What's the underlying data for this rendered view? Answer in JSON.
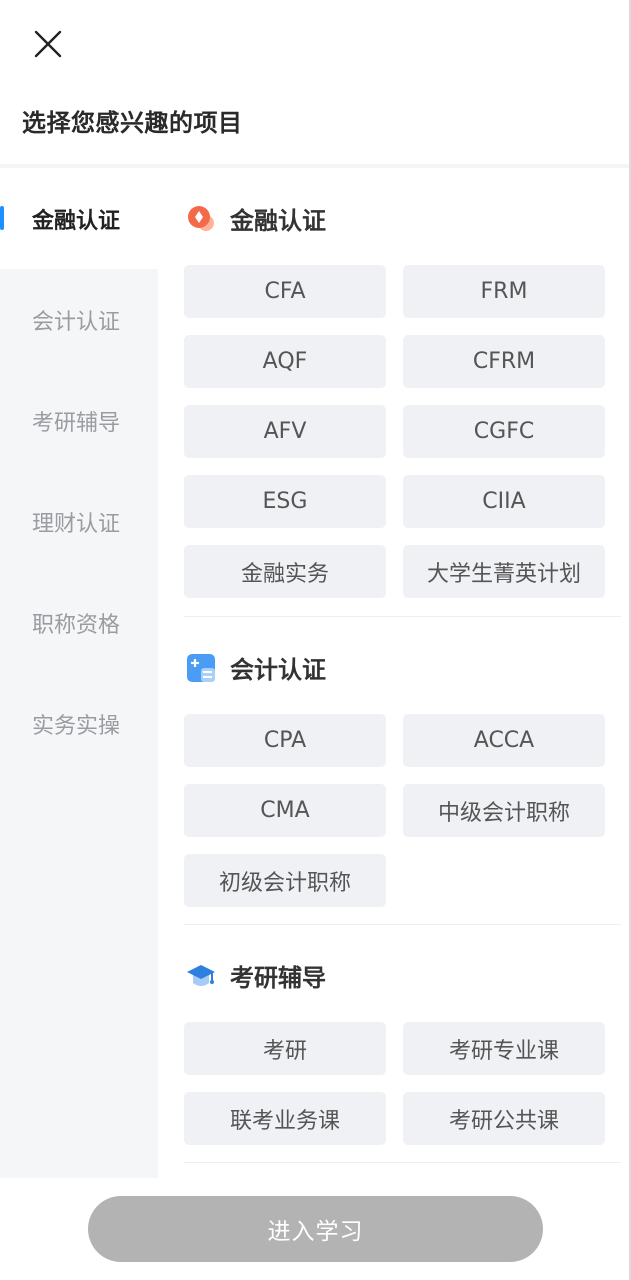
{
  "header": {
    "title": "选择您感兴趣的项目"
  },
  "sidebar": {
    "items": [
      {
        "label": "金融认证",
        "active": true
      },
      {
        "label": "会计认证"
      },
      {
        "label": "考研辅导"
      },
      {
        "label": "理财认证"
      },
      {
        "label": "职称资格"
      },
      {
        "label": "实务实操"
      }
    ]
  },
  "sections": [
    {
      "title": "金融认证",
      "icon": "finance-icon",
      "items": [
        "CFA",
        "FRM",
        "AQF",
        "CFRM",
        "AFV",
        "CGFC",
        "ESG",
        "CIIA",
        "金融实务",
        "大学生菁英计划"
      ]
    },
    {
      "title": "会计认证",
      "icon": "accounting-icon",
      "items": [
        "CPA",
        "ACCA",
        "CMA",
        "中级会计职称",
        "初级会计职称"
      ]
    },
    {
      "title": "考研辅导",
      "icon": "graduation-cap-icon",
      "items": [
        "考研",
        "考研专业课",
        "联考业务课",
        "考研公共课"
      ]
    }
  ],
  "footer": {
    "button_label": "进入学习"
  },
  "colors": {
    "accent": "#1f8fff",
    "disabled_button": "#b3b3b3",
    "sidebar_bg": "#f5f6f8",
    "chip_bg": "#f0f1f4"
  }
}
